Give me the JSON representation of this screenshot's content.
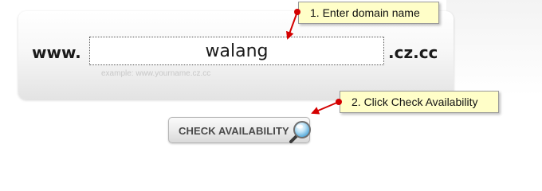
{
  "domain_form": {
    "prefix": "www.",
    "input_value": "walang",
    "suffix": ".cz.cc",
    "example_hint": "example: www.yourname.cz.cc"
  },
  "callouts": {
    "step1": "1. Enter domain name",
    "step2": "2. Click Check Availability"
  },
  "check_button": {
    "label": "CHECK AVAILABILITY",
    "icon": "magnifier-icon"
  },
  "colors": {
    "callout_bg": "#fffec8",
    "arrow": "#d40000",
    "text": "#1a1a1a"
  }
}
